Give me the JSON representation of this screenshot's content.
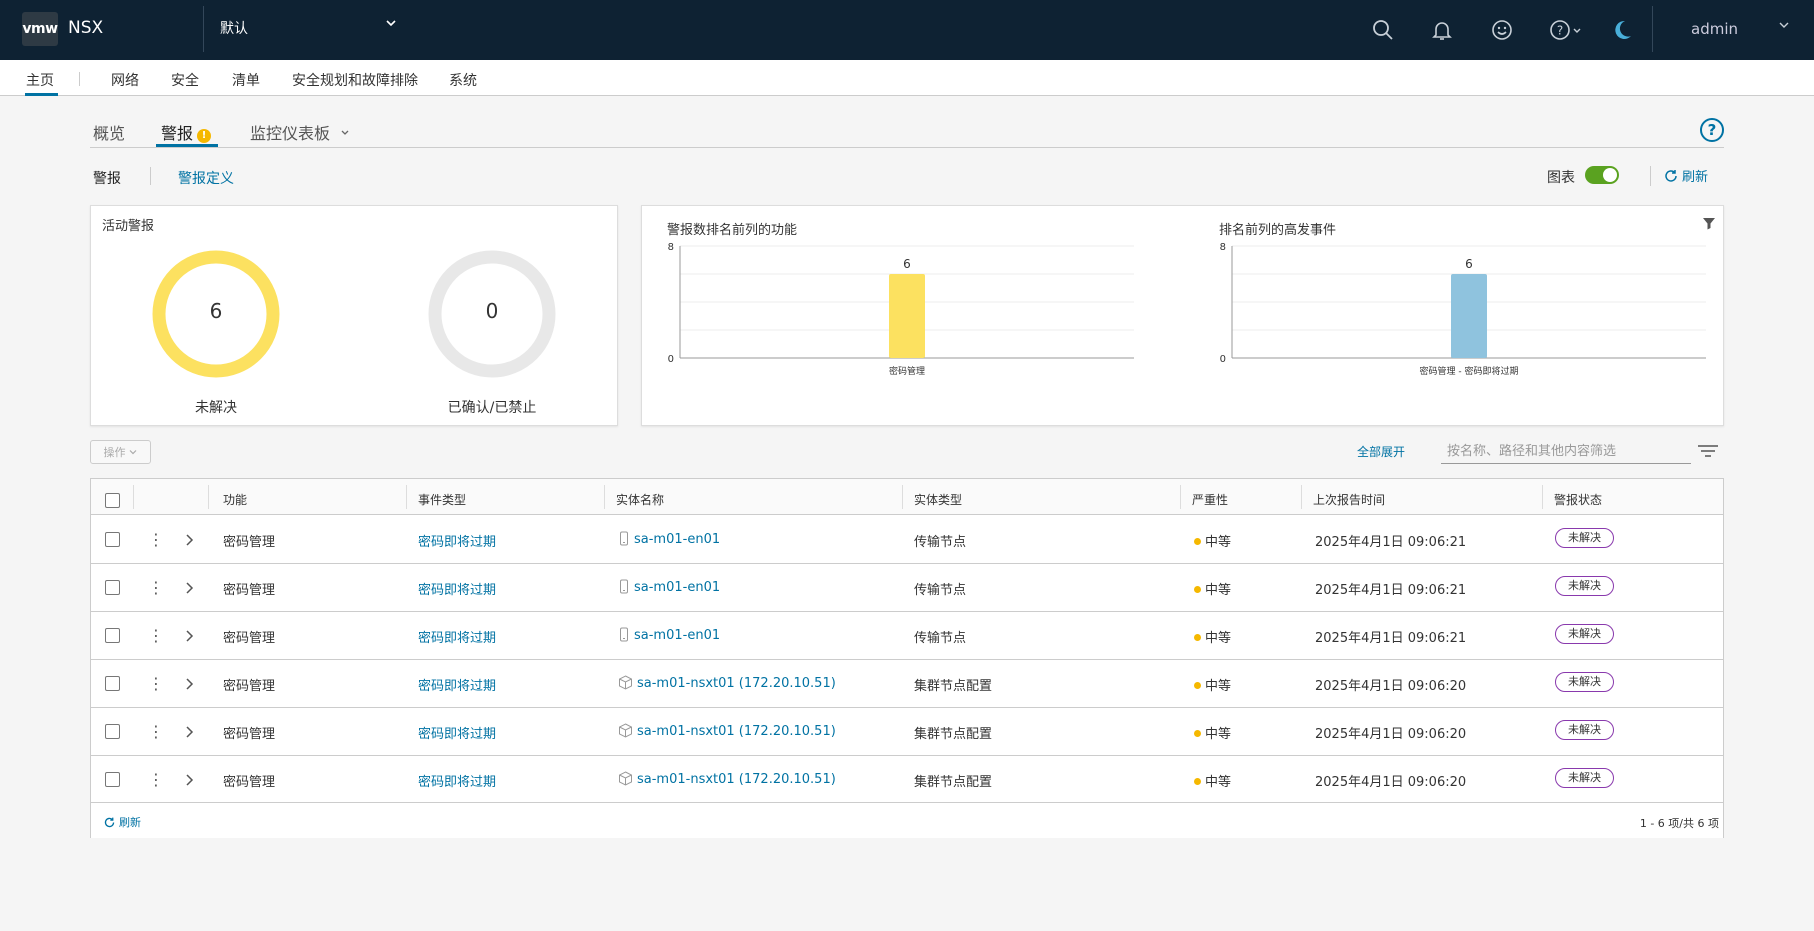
{
  "header": {
    "logo": "vmw",
    "app_name": "NSX",
    "project": "默认",
    "user": "admin",
    "icons": [
      "search-icon",
      "bell-icon",
      "smiley-icon",
      "help-icon",
      "moon-icon"
    ]
  },
  "nav": {
    "items": [
      "主页",
      "网络",
      "安全",
      "清单",
      "安全规划和故障排除",
      "系统"
    ]
  },
  "tabs": [
    "概览",
    "警报",
    "监控仪表板"
  ],
  "tab_warning": "!",
  "subtabs": {
    "alarms": "警报",
    "alarm_defs": "警报定义"
  },
  "toolbar": {
    "chart_label": "图表",
    "chart_on": true,
    "refresh": "刷新"
  },
  "active_alarms": {
    "title": "活动警报",
    "open": {
      "value": "6",
      "label": "未解决"
    },
    "ack": {
      "value": "0",
      "label": "已确认/已禁止"
    },
    "colors": {
      "open": "#fce160",
      "ack": "#e8e8e8"
    }
  },
  "chart_data": [
    {
      "type": "bar",
      "title": "警报数排名前列的功能",
      "categories": [
        "密码管理"
      ],
      "values": [
        6
      ],
      "ylim": [
        0,
        8
      ],
      "ticks": [
        "8",
        "0"
      ],
      "data_labels": [
        "6"
      ],
      "color": "#fce160"
    },
    {
      "type": "bar",
      "title": "排名前列的高发事件",
      "categories": [
        "密码管理 - 密码即将过期"
      ],
      "values": [
        6
      ],
      "ylim": [
        0,
        8
      ],
      "ticks": [
        "8",
        "0"
      ],
      "data_labels": [
        "6"
      ],
      "color": "#8fc3de"
    }
  ],
  "table": {
    "ops_label": "操作",
    "expand_all": "全部展开",
    "filter_placeholder": "按名称、路径和其他内容筛选",
    "columns": [
      "功能",
      "事件类型",
      "实体名称",
      "实体类型",
      "严重性",
      "上次报告时间",
      "警报状态"
    ],
    "rows": [
      {
        "feature": "密码管理",
        "event": "密码即将过期",
        "entity": "sa-m01-en01",
        "etype": "传输节点",
        "severity": "中等",
        "time": "2025年4月1日 09:06:21",
        "status": "未解决",
        "icon": "phone-icon"
      },
      {
        "feature": "密码管理",
        "event": "密码即将过期",
        "entity": "sa-m01-en01",
        "etype": "传输节点",
        "severity": "中等",
        "time": "2025年4月1日 09:06:21",
        "status": "未解决",
        "icon": "phone-icon"
      },
      {
        "feature": "密码管理",
        "event": "密码即将过期",
        "entity": "sa-m01-en01",
        "etype": "传输节点",
        "severity": "中等",
        "time": "2025年4月1日 09:06:21",
        "status": "未解决",
        "icon": "phone-icon"
      },
      {
        "feature": "密码管理",
        "event": "密码即将过期",
        "entity": "sa-m01-nsxt01 (172.20.10.51)",
        "etype": "集群节点配置",
        "severity": "中等",
        "time": "2025年4月1日 09:06:20",
        "status": "未解决",
        "icon": "cube-icon"
      },
      {
        "feature": "密码管理",
        "event": "密码即将过期",
        "entity": "sa-m01-nsxt01 (172.20.10.51)",
        "etype": "集群节点配置",
        "severity": "中等",
        "time": "2025年4月1日 09:06:20",
        "status": "未解决",
        "icon": "cube-icon"
      },
      {
        "feature": "密码管理",
        "event": "密码即将过期",
        "entity": "sa-m01-nsxt01 (172.20.10.51)",
        "etype": "集群节点配置",
        "severity": "中等",
        "time": "2025年4月1日 09:06:20",
        "status": "未解决",
        "icon": "cube-icon"
      }
    ],
    "footer_refresh": "刷新",
    "footer_count": "1 - 6 项/共 6 项"
  }
}
